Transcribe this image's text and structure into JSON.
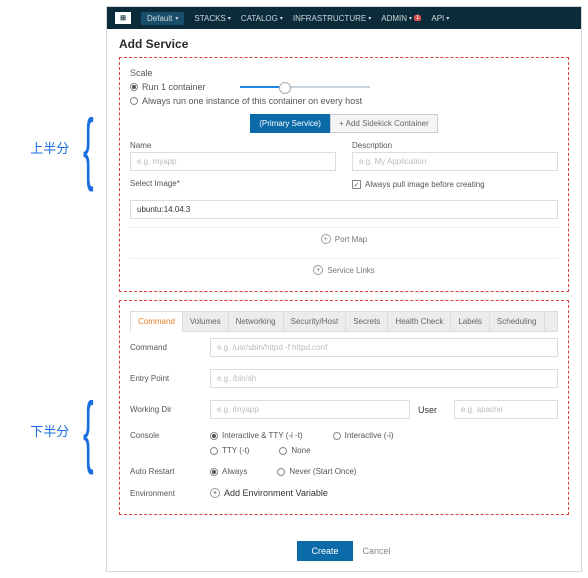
{
  "annotations": {
    "upper": "上半分",
    "lower": "下半分"
  },
  "nav": {
    "env": "Default",
    "items": [
      "STACKS",
      "CATALOG",
      "INFRASTRUCTURE",
      "ADMIN",
      "API"
    ],
    "admin_badge": "1"
  },
  "page_title": "Add Service",
  "scale": {
    "label": "Scale",
    "opt1": "Run 1 container",
    "opt2": "Always run one instance of this container on every host"
  },
  "svc_buttons": {
    "primary": "(Primary Service)",
    "sidekick": "Add Sidekick Container"
  },
  "fields": {
    "name_label": "Name",
    "name_ph": "e.g. myapp",
    "desc_label": "Description",
    "desc_ph": "e.g. My Application",
    "image_label": "Select Image*",
    "image_val": "ubuntu:14.04.3",
    "pull_label": "Always pull image before creating"
  },
  "expand": {
    "portmap": "Port Map",
    "links": "Service Links"
  },
  "tabs": [
    "Command",
    "Volumes",
    "Networking",
    "Security/Host",
    "Secrets",
    "Health Check",
    "Labels",
    "Scheduling"
  ],
  "cmd": {
    "command_label": "Command",
    "command_ph": "e.g. /usr/sbin/httpd -f httpd.conf",
    "entry_label": "Entry Point",
    "entry_ph": "e.g. /bin/sh",
    "workdir_label": "Working Dir",
    "workdir_ph": "e.g. /myapp",
    "user_label": "User",
    "user_ph": "e.g. apache",
    "console_label": "Console",
    "console_opts": {
      "a": "Interactive & TTY (-i -t)",
      "b": "Interactive (-i)",
      "c": "TTY (-t)",
      "d": "None"
    },
    "restart_label": "Auto Restart",
    "restart_opts": {
      "a": "Always",
      "b": "Never (Start Once)"
    },
    "env_label": "Environment",
    "env_add": "Add Environment Variable"
  },
  "footer": {
    "create": "Create",
    "cancel": "Cancel"
  }
}
